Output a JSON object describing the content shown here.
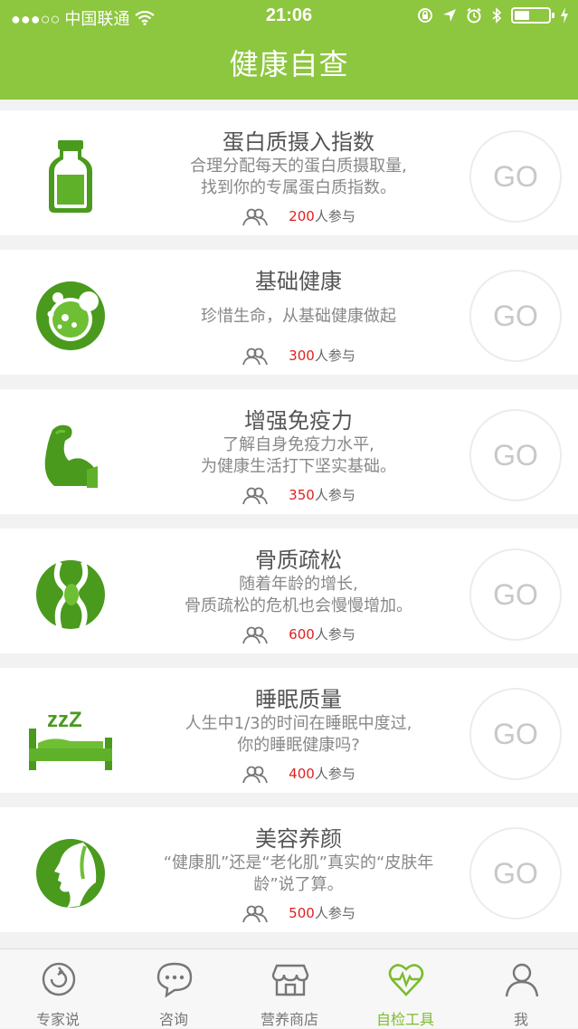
{
  "status_bar": {
    "carrier": "●●●○○ 中国联通",
    "time": "21:06"
  },
  "header": {
    "title": "健康自查"
  },
  "accent_color": "#8dc63f",
  "count_color": "#e02020",
  "cards": [
    {
      "icon": "milk-bottle-icon",
      "title": "蛋白质摄入指数",
      "desc": [
        "合理分配每天的蛋白质摄取量,",
        "找到你的专属蛋白质指数。"
      ],
      "count": "200",
      "count_suffix": "人参与",
      "go": "GO"
    },
    {
      "icon": "cells-icon",
      "title": "基础健康",
      "desc": [
        "珍惜生命，从基础健康做起"
      ],
      "count": "300",
      "count_suffix": "人参与",
      "go": "GO"
    },
    {
      "icon": "muscle-arm-icon",
      "title": "增强免疫力",
      "desc": [
        "了解自身免疫力水平,",
        "为健康生活打下坚实基础。"
      ],
      "count": "350",
      "count_suffix": "人参与",
      "go": "GO"
    },
    {
      "icon": "bone-joint-icon",
      "title": "骨质疏松",
      "desc": [
        "随着年龄的增长,",
        "骨质疏松的危机也会慢慢增加。"
      ],
      "count": "600",
      "count_suffix": "人参与",
      "go": "GO"
    },
    {
      "icon": "sleep-bed-icon",
      "title": "睡眠质量",
      "desc": [
        "人生中1/3的时间在睡眠中度过,",
        "你的睡眠健康吗?"
      ],
      "count": "400",
      "count_suffix": "人参与",
      "go": "GO"
    },
    {
      "icon": "face-profile-icon",
      "title": "美容养颜",
      "desc": [
        "“健康肌”还是“老化肌”真实的“皮肤年",
        "龄”说了算。"
      ],
      "count": "500",
      "count_suffix": "人参与",
      "go": "GO"
    }
  ],
  "tabs": [
    {
      "label": "专家说",
      "icon": "expert-refresh-icon",
      "active": false
    },
    {
      "label": "咨询",
      "icon": "chat-bubble-icon",
      "active": false
    },
    {
      "label": "营养商店",
      "icon": "store-icon",
      "active": false
    },
    {
      "label": "自检工具",
      "icon": "heart-pulse-icon",
      "active": true
    },
    {
      "label": "我",
      "icon": "user-icon",
      "active": false
    }
  ]
}
